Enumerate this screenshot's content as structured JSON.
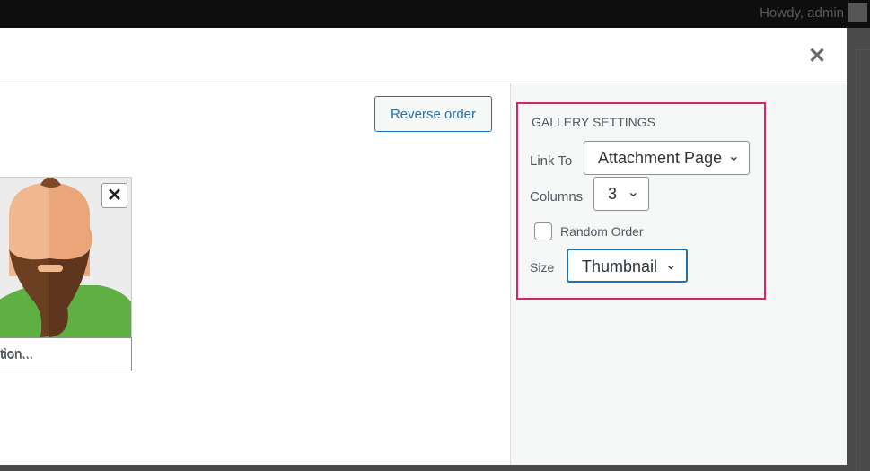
{
  "adminbar": {
    "greeting": "Howdy, admin"
  },
  "modal": {
    "close_icon": "close-icon",
    "reverse_order": "Reverse order"
  },
  "gallery_item": {
    "caption_placeholder": "Caption...",
    "caption_visible": "tion..."
  },
  "settings": {
    "heading": "Gallery Settings",
    "link_to_label": "Link To",
    "link_to_value": "Attachment Page",
    "columns_label": "Columns",
    "columns_value": "3",
    "random_label": "Random Order",
    "random_checked": false,
    "size_label": "Size",
    "size_value": "Thumbnail",
    "highlight_color": "#e0245e"
  }
}
